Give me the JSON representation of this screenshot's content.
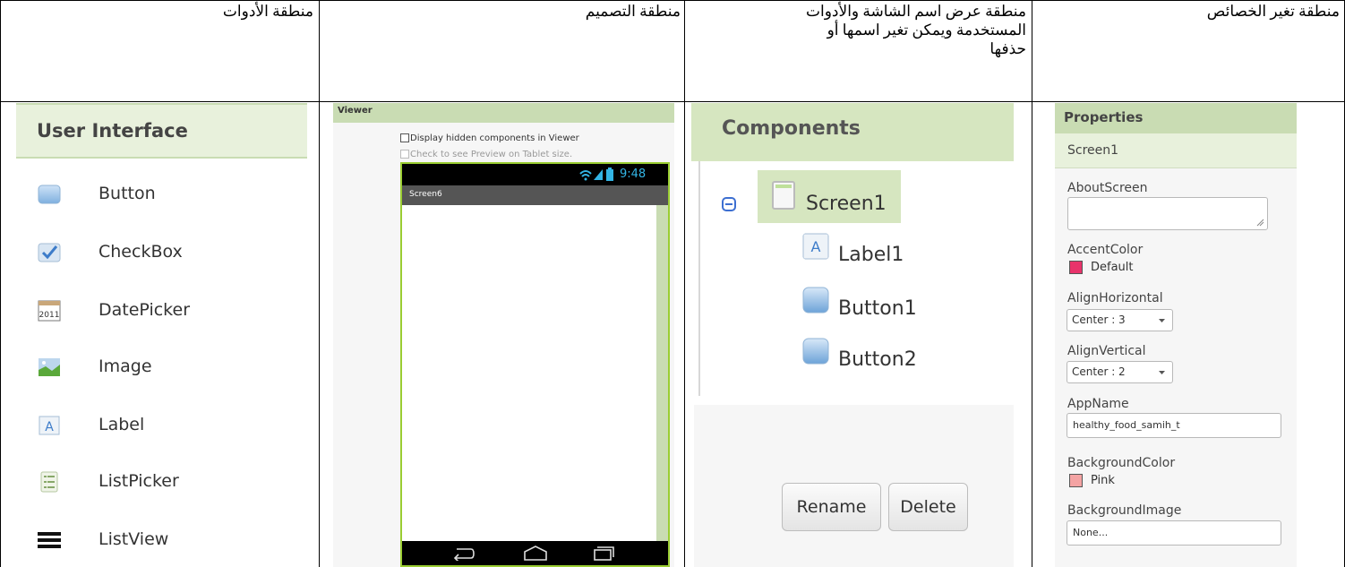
{
  "headers": {
    "tools": "منطقة الأدوات",
    "design": "منطقة التصميم",
    "components_line1": "منطقة عرض اسم الشاشة والأدوات",
    "components_line2": "المستخدمة ويمكن  تغير اسمها أو",
    "components_line3": "حذفها",
    "properties": "منطقة تغير الخصائص"
  },
  "palette": {
    "title": "User Interface",
    "items": [
      {
        "label": "Button",
        "icon": "button-icon"
      },
      {
        "label": "CheckBox",
        "icon": "checkbox-icon"
      },
      {
        "label": "DatePicker",
        "icon": "datepicker-icon"
      },
      {
        "label": "Image",
        "icon": "image-icon"
      },
      {
        "label": "Label",
        "icon": "label-icon"
      },
      {
        "label": "ListPicker",
        "icon": "listpicker-icon"
      },
      {
        "label": "ListView",
        "icon": "listview-icon"
      }
    ],
    "datepicker_text": "2011",
    "label_letter": "A"
  },
  "viewer": {
    "title": "Viewer",
    "hidden_checkbox": "Display hidden components in Viewer",
    "tablet_checkbox": "Check to see Preview on Tablet size.",
    "time": "9:48",
    "screen_title": "Screen6"
  },
  "components": {
    "title": "Components",
    "tree": {
      "root": "Screen1",
      "children": [
        "Label1",
        "Button1",
        "Button2"
      ],
      "label_letter": "A"
    },
    "rename": "Rename",
    "delete": "Delete"
  },
  "properties": {
    "title": "Properties",
    "screen": "Screen1",
    "about_screen_label": "AboutScreen",
    "about_screen_value": "",
    "accent_color_label": "AccentColor",
    "accent_color_value": "Default",
    "align_horizontal_label": "AlignHorizontal",
    "align_horizontal_value": "Center : 3",
    "align_vertical_label": "AlignVertical",
    "align_vertical_value": "Center : 2",
    "app_name_label": "AppName",
    "app_name_value": "healthy_food_samih_t",
    "background_color_label": "BackgroundColor",
    "background_color_value": "Pink",
    "background_image_label": "BackgroundImage",
    "background_image_value": "None..."
  },
  "colors": {
    "accent": "#e8336b",
    "pink": "#f4a3a3",
    "header_green": "#c9dcb3"
  }
}
